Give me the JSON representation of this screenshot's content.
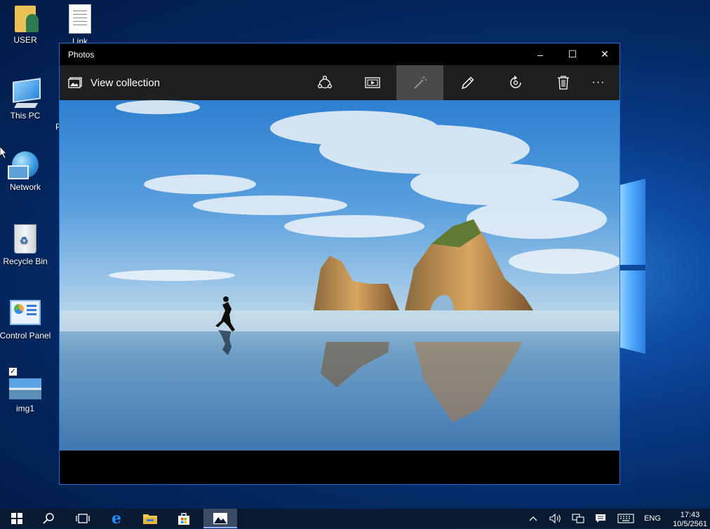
{
  "desktop": {
    "icons": [
      {
        "label": "USER"
      },
      {
        "label": "Link"
      },
      {
        "label": "This PC"
      },
      {
        "label": "Network"
      },
      {
        "label": "Recycle Bin"
      },
      {
        "label": "Control Panel"
      },
      {
        "label": "img1"
      }
    ],
    "partial_label": "P"
  },
  "window": {
    "title": "Photos",
    "controls": {
      "minimize": "–",
      "maximize": "☐",
      "close": "✕"
    },
    "toolbar": {
      "view_collection": "View collection",
      "more": "···"
    }
  },
  "taskbar": {
    "language": "ENG",
    "time": "17:43",
    "date": "10/5/2561"
  },
  "colors": {
    "window_border": "#1f6fd1",
    "toolbar_bg": "#1f1f1f",
    "active_tool": "#4a4a4a",
    "taskbar_bg": "#0a1a33"
  }
}
